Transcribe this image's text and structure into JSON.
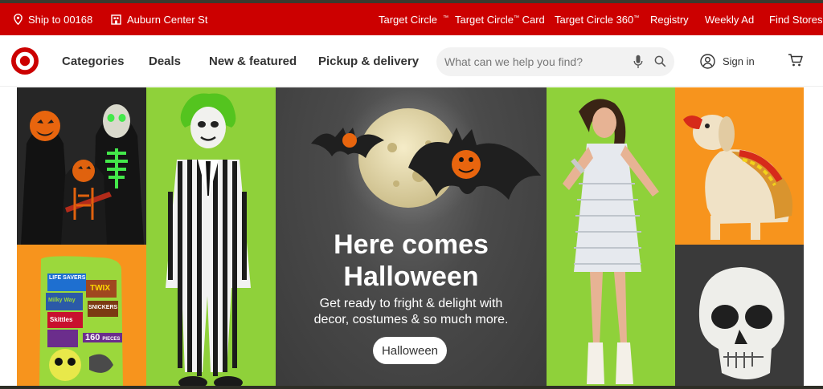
{
  "colors": {
    "brand_red": "#cc0000",
    "hero_dark": "#3b3b3b",
    "lime": "#8fd13a",
    "orange": "#f7941d"
  },
  "utility": {
    "ship_to": "Ship to 00168",
    "store": "Auburn Center St",
    "links": [
      {
        "label": "Target Circle",
        "tm": "™"
      },
      {
        "label": "Target Circle",
        "tm": "™",
        "suffix": " Card"
      },
      {
        "label": "Target Circle 360",
        "tm": "™"
      },
      {
        "label": "Registry"
      },
      {
        "label": "Weekly Ad"
      },
      {
        "label": "Find Stores"
      }
    ]
  },
  "header": {
    "logo": "target-bullseye-logo",
    "nav": [
      "Categories",
      "Deals",
      "New & featured",
      "Pickup & delivery"
    ],
    "search_placeholder": "What can we help you find?",
    "signin": "Sign in"
  },
  "hero": {
    "title_line1": "Here comes",
    "title_line2": "Halloween",
    "subtitle_line1": "Get ready to fright & delight with",
    "subtitle_line2": "decor, costumes & so much more.",
    "button": "Halloween",
    "candy": {
      "brand1": "LIFE SAVERS",
      "brand2": "TWIX",
      "brand3": "Milky Way",
      "brand4": "SNICKERS",
      "brand5": "Skittles",
      "count": "160",
      "count_label": "PIECES"
    }
  }
}
